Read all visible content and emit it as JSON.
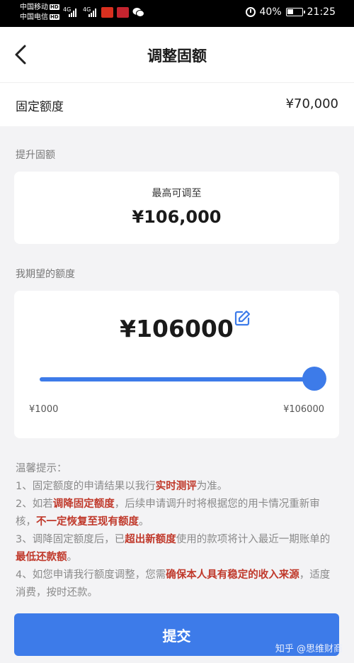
{
  "status_bar": {
    "carrier_1": "中国移动",
    "carrier_2": "中国电信",
    "hd_badge": "HD",
    "network": "4G",
    "battery": "40%",
    "time": "21:25",
    "icons": [
      "signal-icon",
      "app-notification-icon",
      "flower-app-icon",
      "wechat-icon",
      "alarm-icon",
      "battery-icon"
    ]
  },
  "nav": {
    "title": "调整固额",
    "back_icon": "chevron-left-icon"
  },
  "fixed_limit": {
    "label": "固定额度",
    "value": "¥70,000"
  },
  "raise_section": {
    "label": "提升固额",
    "max_label": "最高可调至",
    "max_value": "¥106,000"
  },
  "desired_section": {
    "label": "我期望的额度",
    "value": "¥106000",
    "edit_icon": "edit-icon",
    "slider_min": "¥1000",
    "slider_max": "¥106000",
    "slider_fraction": 1.0
  },
  "tips": {
    "title": "温馨提示：",
    "item1_a": "1、固定额度的申请结果以我行",
    "item1_hl": "实时测评",
    "item1_b": "为准。",
    "item2_a": "2、如若",
    "item2_hl1": "调降固定额度",
    "item2_b": "，后续申请调升时将根据您的用卡情况重新审核，",
    "item2_hl2": "不一定恢复至现有额度",
    "item2_c": "。",
    "item3_a": "3、调降固定额度后，已",
    "item3_hl1": "超出新额度",
    "item3_b": "使用的款项将计入最近一期账单的",
    "item3_hl2": "最低还款额",
    "item3_c": "。",
    "item4_a": "4、如您申请我行额度调整，您需",
    "item4_hl": "确保本人具有稳定的收入来源",
    "item4_b": "，适度消费，按时还款。"
  },
  "submit": {
    "label": "提交"
  },
  "watermark": "知乎 @思维财商",
  "colors": {
    "accent": "#3d7be9",
    "highlight": "#c0392b",
    "background": "#f3f3f5"
  }
}
